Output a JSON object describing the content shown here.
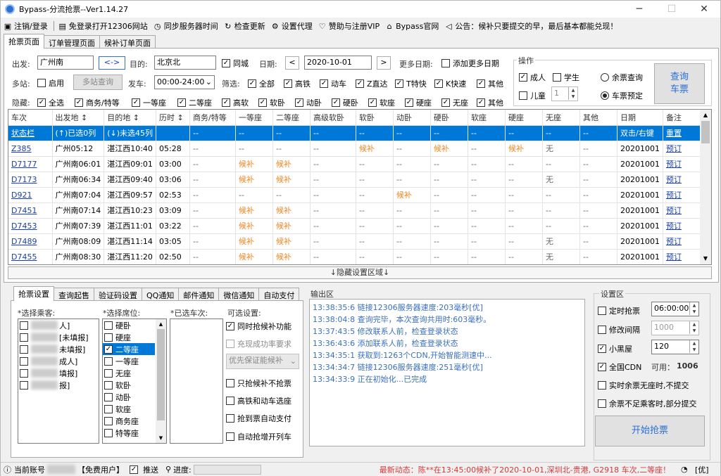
{
  "window": {
    "title": "Bypass-分流抢票--Ver1.14.27"
  },
  "menu": [
    "注销/登录",
    "免登录打开12306网站",
    "同步服务器时间",
    "检查更新",
    "设置代理",
    "赞助与注册VIP",
    "Bypass官网",
    "公告：候补只要提交的早，最后基本都能兑现！"
  ],
  "tabs": [
    "抢票页面",
    "订单管理页面",
    "候补订单页面"
  ],
  "form": {
    "from_label": "出发:",
    "from_value": "广州南",
    "swap_label": "<->",
    "to_label": "目的:",
    "to_value": "北京北",
    "same_city": "同城",
    "date_label": "日期:",
    "date_value": "2020-10-01",
    "more_dates": "更多日期:",
    "add_more_dates": "添加更多日期",
    "multi_label": "多站:",
    "enable": "启用",
    "multi_query": "多站查询",
    "depart_label": "发车:",
    "depart_value": "00:00-24:00",
    "filter_label": "筛选:",
    "filters": [
      "全部",
      "高铁",
      "动车",
      "Z直达",
      "T特快",
      "K快速",
      "其他"
    ],
    "hide_label": "隐藏:",
    "hides": [
      "全选",
      "商务/特等",
      "一等座",
      "二等座",
      "高软",
      "软卧",
      "动卧",
      "硬卧",
      "软座",
      "硬座",
      "无座",
      "其他"
    ],
    "ops_label": "操作",
    "adult": "成人",
    "student": "学生",
    "child": "儿童",
    "child_count": "1",
    "remaining_query": "余票查询",
    "ticket_book": "车票预定",
    "query_btn": "查询\n车票"
  },
  "grid": {
    "headers": [
      "车次",
      "出发地 ↕",
      "目的地 ↕",
      "历时 ↕",
      "商务/特等",
      "一等座",
      "二等座",
      "高级软卧",
      "软卧",
      "动卧",
      "硬卧",
      "软座",
      "硬座",
      "无座",
      "其他",
      "日期",
      "备注"
    ],
    "status_row": [
      "状态栏",
      "(↑)已选0列",
      "(↓)未选45列",
      "",
      "--",
      "--",
      "--",
      "--",
      "--",
      "--",
      "--",
      "--",
      "--",
      "--",
      "--",
      "双击/右键",
      "重置"
    ],
    "rows": [
      [
        "Z385",
        "广州05:12",
        "湛江西10:40",
        "05:28",
        "--",
        "--",
        "--",
        "--",
        "候补",
        "--",
        "候补",
        "--",
        "候补",
        "无",
        "--",
        "20201001",
        "预订"
      ],
      [
        "D7177",
        "广州南06:01",
        "湛江西09:01",
        "03:00",
        "--",
        "候补",
        "候补",
        "--",
        "--",
        "--",
        "--",
        "--",
        "--",
        "--",
        "--",
        "20201001",
        "预订"
      ],
      [
        "D7173",
        "广州南06:34",
        "湛江西09:40",
        "03:06",
        "--",
        "候补",
        "候补",
        "--",
        "--",
        "--",
        "--",
        "--",
        "--",
        "无",
        "--",
        "20201001",
        "预订"
      ],
      [
        "D921",
        "广州南07:04",
        "湛江西09:57",
        "02:53",
        "--",
        "--",
        "--",
        "--",
        "--",
        "候补",
        "--",
        "--",
        "--",
        "--",
        "--",
        "20201001",
        "预订"
      ],
      [
        "D7451",
        "广州南07:14",
        "湛江西10:23",
        "03:09",
        "--",
        "候补",
        "候补",
        "--",
        "--",
        "--",
        "--",
        "--",
        "--",
        "--",
        "--",
        "20201001",
        "预订"
      ],
      [
        "D7453",
        "广州南07:39",
        "湛江西11:01",
        "03:22",
        "--",
        "候补",
        "候补",
        "--",
        "--",
        "--",
        "--",
        "--",
        "--",
        "--",
        "--",
        "20201001",
        "预订"
      ],
      [
        "D7489",
        "广州南08:09",
        "湛江西11:14",
        "03:05",
        "--",
        "候补",
        "候补",
        "--",
        "--",
        "--",
        "--",
        "--",
        "--",
        "无",
        "--",
        "20201001",
        "预订"
      ],
      [
        "D7455",
        "广州南08:30",
        "湛江西11:20",
        "02:50",
        "--",
        "候补",
        "候补",
        "--",
        "--",
        "--",
        "--",
        "--",
        "--",
        "无",
        "--",
        "20201001",
        "预订"
      ]
    ]
  },
  "hide_bar": "↓隐藏设置区域↓",
  "bottom_tabs": [
    "抢票设置",
    "查询起售",
    "验证码设置",
    "QQ通知",
    "邮件通知",
    "微信通知",
    "自动支付"
  ],
  "passengers": {
    "label": "*选择乘客:",
    "items": [
      "人]",
      "[未填报]",
      "未填报]",
      "成人]",
      "填报]",
      "报]"
    ]
  },
  "seats": {
    "label": "*选择席位:",
    "items": [
      "硬卧",
      "硬座",
      "二等座",
      "一等座",
      "无座",
      "软卧",
      "动卧",
      "软座",
      "商务座",
      "特等座"
    ]
  },
  "selected_trains": {
    "label": "*已选车次:"
  },
  "options": {
    "label": "可选设置:",
    "items": [
      "同时抢候补功能",
      "充现成功率要求",
      "优先保证能候补",
      "只抢候补不抢票",
      "高铁和动车选座",
      "抢到票自动支付",
      "自动抢增开列车"
    ]
  },
  "output": {
    "label": "输出区",
    "lines": [
      "13:38:35:6  链接12306服务器速度:203毫秒[优]",
      "13:38:04:8  查询完毕，本次查询共用时:603毫秒。",
      "13:37:43:5  修改联系人前，检查登录状态",
      "13:36:43:6  添加联系人前，检查登录状态",
      "13:34:35:1  获取到:1263个CDN,开始智能测速中...",
      "13:34:34:7  链接12306服务器速度:251毫秒[优]",
      "13:34:33:9  正在初始化...已完成"
    ]
  },
  "settings": {
    "label": "设置区",
    "timed": "定时抢票",
    "timed_value": "06:00:00",
    "interval": "修改间隔",
    "interval_value": "1000",
    "blackroom": "小黑屋",
    "blackroom_value": "120",
    "cdn": "全国CDN",
    "cdn_avail_label": "可用：",
    "cdn_avail": "1006",
    "no_seat": "实时余票无座时,不提交",
    "partial": "余票不足乘客时,部分提交",
    "start_btn": "开始抢票"
  },
  "status": {
    "account_label": "当前账号",
    "user_type": "【免费用户】",
    "push": "推送",
    "progress": "进度:",
    "news": "最新动态：陈**在13:45:00候补了2020-10-01,深圳北-贵港, G2918 车次,二等座！",
    "signal": "[优]"
  },
  "colors": {
    "selection": "#0078d7",
    "orange": "#e88a2a",
    "link": "#1a3fb0",
    "log": "#3a6fbd",
    "news": "#d23b3b"
  }
}
